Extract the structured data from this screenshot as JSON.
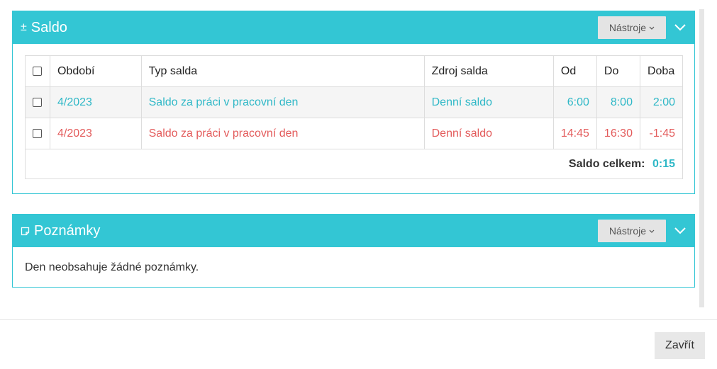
{
  "saldo_panel": {
    "icon_glyph": "±",
    "title": "Saldo",
    "tools_label": "Nástroje",
    "columns": {
      "period": "Období",
      "type": "Typ salda",
      "source": "Zdroj salda",
      "from": "Od",
      "to": "Do",
      "duration": "Doba"
    },
    "rows": [
      {
        "period": "4/2023",
        "type": "Saldo za práci v pracovní den",
        "source": "Denní saldo",
        "from": "6:00",
        "to": "8:00",
        "duration": "2:00"
      },
      {
        "period": "4/2023",
        "type": "Saldo za práci v pracovní den",
        "source": "Denní saldo",
        "from": "14:45",
        "to": "16:30",
        "duration": "-1:45"
      }
    ],
    "total_label": "Saldo celkem:",
    "total_value": "0:15"
  },
  "notes_panel": {
    "title": "Poznámky",
    "tools_label": "Nástroje",
    "empty_text": "Den neobsahuje žádné poznámky."
  },
  "footer": {
    "close_label": "Zavřít"
  },
  "colors": {
    "accent": "#33c6d4",
    "positive": "#2fb8c7",
    "negative": "#e35b5b"
  }
}
